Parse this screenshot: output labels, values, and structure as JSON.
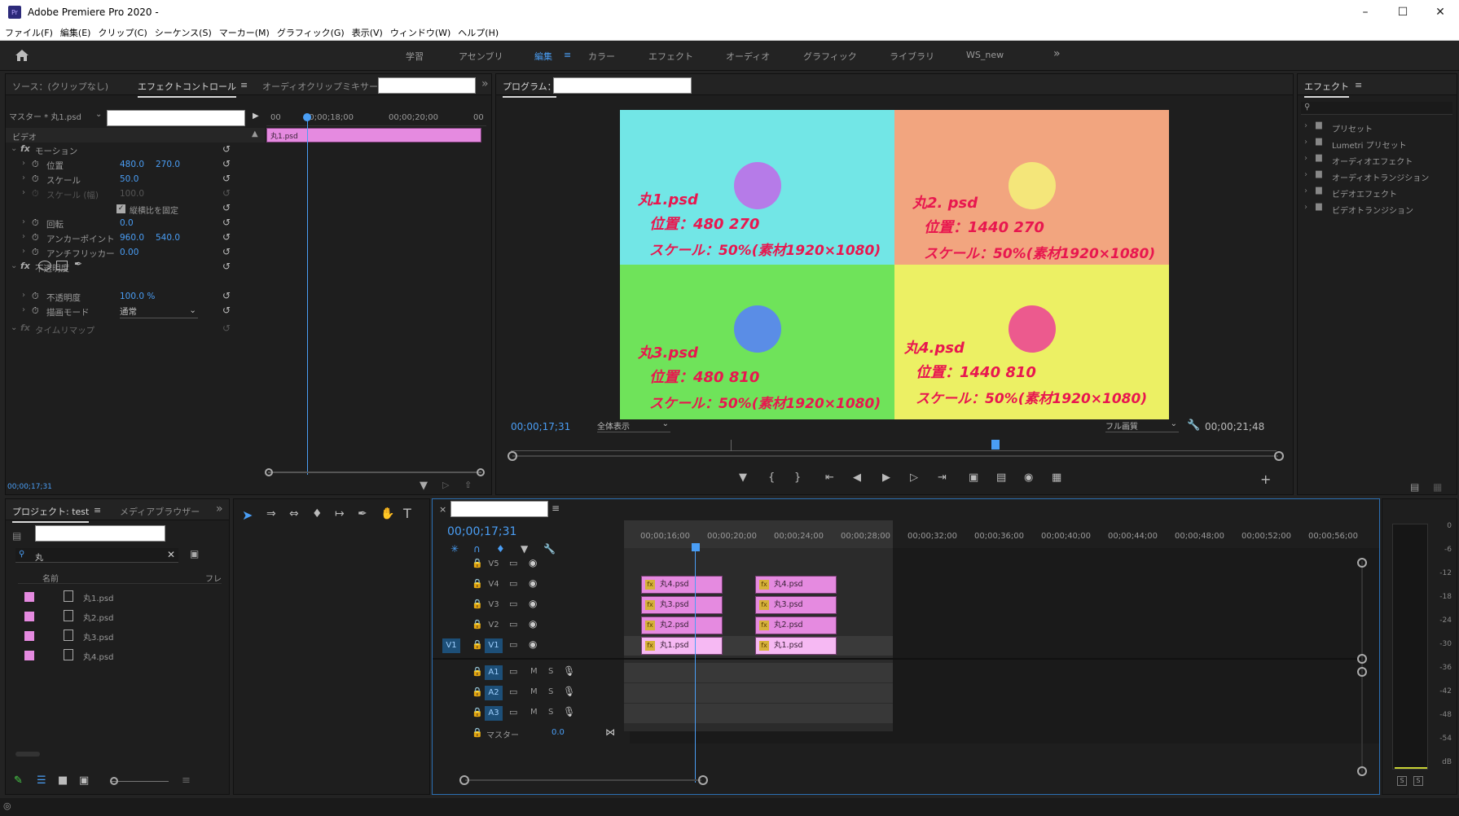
{
  "app": {
    "title": "Adobe Premiere Pro 2020 -",
    "icon": "Pr"
  },
  "menu": [
    "ファイル(F)",
    "編集(E)",
    "クリップ(C)",
    "シーケンス(S)",
    "マーカー(M)",
    "グラフィック(G)",
    "表示(V)",
    "ウィンドウ(W)",
    "ヘルプ(H)"
  ],
  "workspaces": [
    "学習",
    "アセンブリ",
    "編集",
    "カラー",
    "エフェクト",
    "オーディオ",
    "グラフィック",
    "ライブラリ",
    "WS_new"
  ],
  "active_workspace": "編集",
  "source_panel": {
    "tabs": [
      "ソース：(クリップなし)",
      "エフェクトコントロール",
      "オーディオクリップミキサー："
    ],
    "master_label": "マスター * 丸1.psd",
    "video_label": "ビデオ",
    "timecodes": [
      "00",
      "00;00;18;00",
      "00;00;20;00",
      "00"
    ],
    "clip_label": "丸1.psd",
    "current_time": "00;00;17;31",
    "props": [
      {
        "name": "モーション",
        "type": "fx"
      },
      {
        "name": "位置",
        "v1": "480.0",
        "v2": "270.0"
      },
      {
        "name": "スケール",
        "v1": "50.0"
      },
      {
        "name": "スケール (幅)",
        "v1": "100.0",
        "disabled": true
      },
      {
        "name": "縦横比を固定",
        "type": "checkbox"
      },
      {
        "name": "回転",
        "v1": "0.0"
      },
      {
        "name": "アンカーポイント",
        "v1": "960.0",
        "v2": "540.0"
      },
      {
        "name": "アンチフリッカー",
        "v1": "0.00"
      },
      {
        "name": "不透明度",
        "type": "fx"
      },
      {
        "name": "不透明度",
        "v1": "100.0 %"
      },
      {
        "name": "描画モード",
        "v1": "通常",
        "type": "select"
      },
      {
        "name": "タイムリマップ",
        "type": "fx",
        "disabled": true
      }
    ]
  },
  "program": {
    "label": "プログラム：",
    "timecode_left": "00;00;17;31",
    "fit": "全体表示",
    "quality": "フル画質",
    "timecode_right": "00;00;21;48",
    "quads": [
      {
        "name": "丸1.psd",
        "pos": "位置：480 270",
        "scale": "スケール：50%(素材1920×1080)",
        "bg": "#72e6e6",
        "circle": "#b67be8"
      },
      {
        "name": "丸2. psd",
        "pos": "位置：1440 270",
        "scale": "スケール：50%(素材1920×1080)",
        "bg": "#f2a57f",
        "circle": "#f4e67a"
      },
      {
        "name": "丸3.psd",
        "pos": "位置：480 810",
        "scale": "スケール：50%(素材1920×1080)",
        "bg": "#6fe35a",
        "circle": "#5a8de6"
      },
      {
        "name": "丸4.psd",
        "pos": "位置：1440 810",
        "scale": "スケール：50%(素材1920×1080)",
        "bg": "#ecf064",
        "circle": "#ec5a8e"
      }
    ]
  },
  "effects": {
    "title": "エフェクト",
    "items": [
      "プリセット",
      "Lumetri プリセット",
      "オーディオエフェクト",
      "オーディオトランジション",
      "ビデオエフェクト",
      "ビデオトランジション"
    ]
  },
  "project": {
    "tabs": [
      "プロジェクト: test",
      "メディアブラウザー"
    ],
    "search": "丸",
    "col_name": "名前",
    "col_fr": "フレ",
    "items": [
      "丸1.psd",
      "丸2.psd",
      "丸3.psd",
      "丸4.psd"
    ]
  },
  "timeline": {
    "timecode": "00;00;17;31",
    "ruler": [
      "00;00;16;00",
      "00;00;20;00",
      "00;00;24;00",
      "00;00;28;00",
      "00;00;32;00",
      "00;00;36;00",
      "00;00;40;00",
      "00;00;44;00",
      "00;00;48;00",
      "00;00;52;00",
      "00;00;56;00"
    ],
    "video_tracks": [
      "V5",
      "V4",
      "V3",
      "V2",
      "V1"
    ],
    "audio_tracks": [
      "A1",
      "A2",
      "A3"
    ],
    "master": {
      "label": "マスター",
      "value": "0.0"
    },
    "clips": {
      "V4": "丸4.psd",
      "V3": "丸3.psd",
      "V2": "丸2.psd",
      "V1": "丸1.psd"
    },
    "src_patch": "V1",
    "m_label": "M",
    "s_label": "S"
  },
  "meter": {
    "ticks": [
      "0",
      "-6",
      "-12",
      "-18",
      "-24",
      "-30",
      "-36",
      "-42",
      "-48",
      "-54",
      "dB"
    ],
    "bottom": [
      "S",
      "S"
    ]
  }
}
